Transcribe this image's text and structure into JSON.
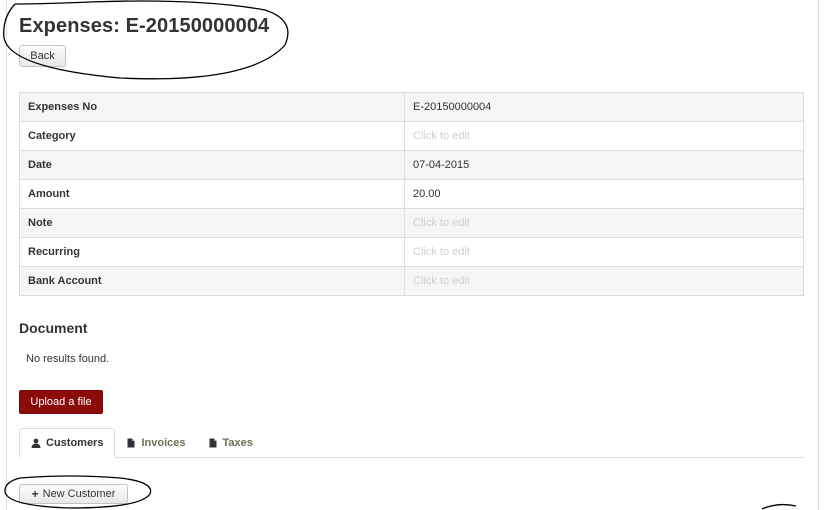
{
  "page": {
    "title": "Expenses: E-20150000004",
    "back_label": "Back"
  },
  "details": {
    "rows": [
      {
        "label": "Expenses No",
        "value": "E-20150000004"
      },
      {
        "label": "Category",
        "value": "Click to edit"
      },
      {
        "label": "Date",
        "value": "07-04-2015"
      },
      {
        "label": "Amount",
        "value": "20.00"
      },
      {
        "label": "Note",
        "value": "Click to edit"
      },
      {
        "label": "Recurring",
        "value": "Click to edit"
      },
      {
        "label": "Bank Account",
        "value": "Click to edit"
      }
    ]
  },
  "document": {
    "heading": "Document",
    "empty_text": "No results found.",
    "upload_label": "Upload a file"
  },
  "tabs": [
    {
      "label": "Customers",
      "icon": "user-icon"
    },
    {
      "label": "Invoices",
      "icon": "file-icon"
    },
    {
      "label": "Taxes",
      "icon": "file-icon"
    }
  ],
  "customers": {
    "new_label": "New Customer",
    "icon": "plus-icon"
  },
  "colors": {
    "upload_button": "#8b0b0b",
    "muted_text": "#cfcfcf",
    "tab_inactive": "#6f6f53",
    "annotation": "#000000"
  }
}
